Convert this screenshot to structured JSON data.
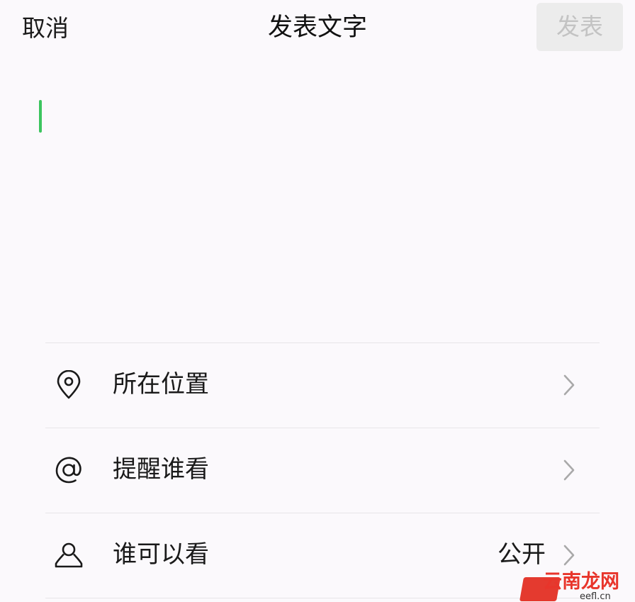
{
  "header": {
    "cancel_label": "取消",
    "title": "发表文字",
    "publish_label": "发表"
  },
  "editor": {
    "value": "",
    "caret_color": "#3cc55f"
  },
  "options": [
    {
      "icon": "location-pin-icon",
      "label": "所在位置",
      "value": ""
    },
    {
      "icon": "at-sign-icon",
      "label": "提醒谁看",
      "value": ""
    },
    {
      "icon": "person-icon",
      "label": "谁可以看",
      "value": "公开"
    }
  ],
  "watermark": {
    "text": "云南龙网",
    "sub": "eefl.cn"
  },
  "colors": {
    "background": "#fbf9fc",
    "publish_bg": "#ececec",
    "publish_text_disabled": "#c3c3c3",
    "watermark_red": "#e43a2f"
  }
}
